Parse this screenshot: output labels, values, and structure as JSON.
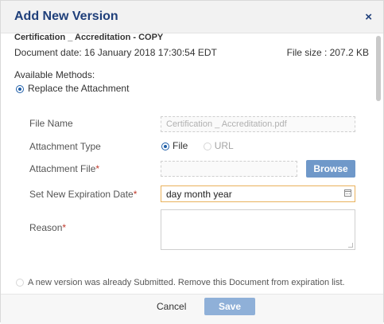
{
  "dialog": {
    "title": "Add New Version",
    "close_label": "×"
  },
  "document": {
    "title": "Certification _ Accreditation - COPY",
    "date": "Document date: 16 January 2018 17:30:54 EDT",
    "file_size": "File size : 207.2 KB"
  },
  "methods": {
    "heading": "Available Methods:",
    "replace_label": "Replace the Attachment",
    "replace_selected": true
  },
  "form": {
    "file_name_label": "File Name",
    "file_name_value": "Certification _ Accreditation.pdf",
    "attachment_type_label": "Attachment Type",
    "type_options": [
      {
        "label": "File",
        "selected": true
      },
      {
        "label": "URL",
        "selected": false
      }
    ],
    "attachment_file_label": "Attachment File",
    "browse_label": "Browse",
    "expiration_label": "Set New Expiration Date",
    "expiration_placeholder": "day month year",
    "reason_label": "Reason",
    "required_mark": "*"
  },
  "notice": {
    "text": "A new version was already Submitted. Remove this Document from expiration list."
  },
  "footer": {
    "cancel_label": "Cancel",
    "save_label": "Save"
  },
  "colors": {
    "title": "#1f3f7a",
    "accent": "#1f5ea8",
    "browse": "#6f98c9",
    "save": "#8fb0d8",
    "required": "#c0392b",
    "date_border": "#e9b25d"
  }
}
